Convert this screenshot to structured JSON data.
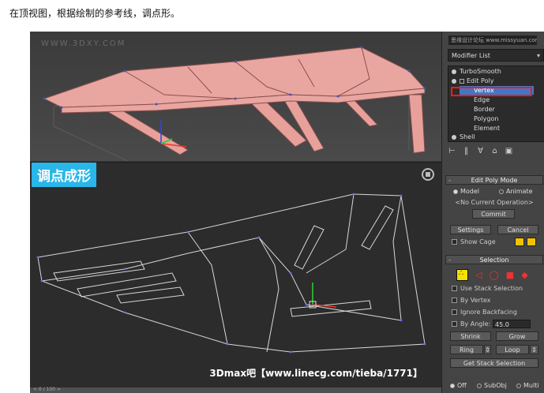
{
  "caption": "在顶视图，根据绘制的参考线，调点形。",
  "top_viewport": {
    "watermark": "WWW.3DXY.COM"
  },
  "bottom_viewport": {
    "banner": "调点成形",
    "credit": "3Dmax吧【www.linecg.com/tieba/1771】"
  },
  "panel": {
    "object_name": "思缘设计论坛 www.missyuan.com",
    "modifier_list": "Modifier List",
    "stack": [
      "TurboSmooth",
      "Edit Poly",
      "Vertex",
      "Edge",
      "Border",
      "Polygon",
      "Element",
      "Shell"
    ],
    "selected_stack_item": "Vertex",
    "edit_poly_mode": {
      "title": "Edit Poly Mode",
      "model": "Model",
      "animate": "Animate",
      "current_operation": "<No Current Operation>",
      "commit": "Commit",
      "settings": "Settings",
      "cancel": "Cancel",
      "show_cage": "Show Cage"
    },
    "selection": {
      "title": "Selection",
      "use_stack_selection": "Use Stack Selection",
      "by_vertex": "By Vertex",
      "ignore_backfacing": "Ignore Backfacing",
      "by_angle": "By Angle:",
      "angle_value": "45.0",
      "shrink": "Shrink",
      "grow": "Grow",
      "ring": "Ring",
      "loop": "Loop",
      "get_stack_selection": "Get Stack Selection",
      "off": "Off",
      "subobj": "SubObj",
      "multi": "Multi"
    }
  },
  "colors": {
    "banner_bg": "#29b6e8",
    "mesh_fill": "#e8a09a",
    "selected_item": "#3f78c7",
    "highlight": "#ff1a1a",
    "cage_swatch": "#f2c200"
  }
}
